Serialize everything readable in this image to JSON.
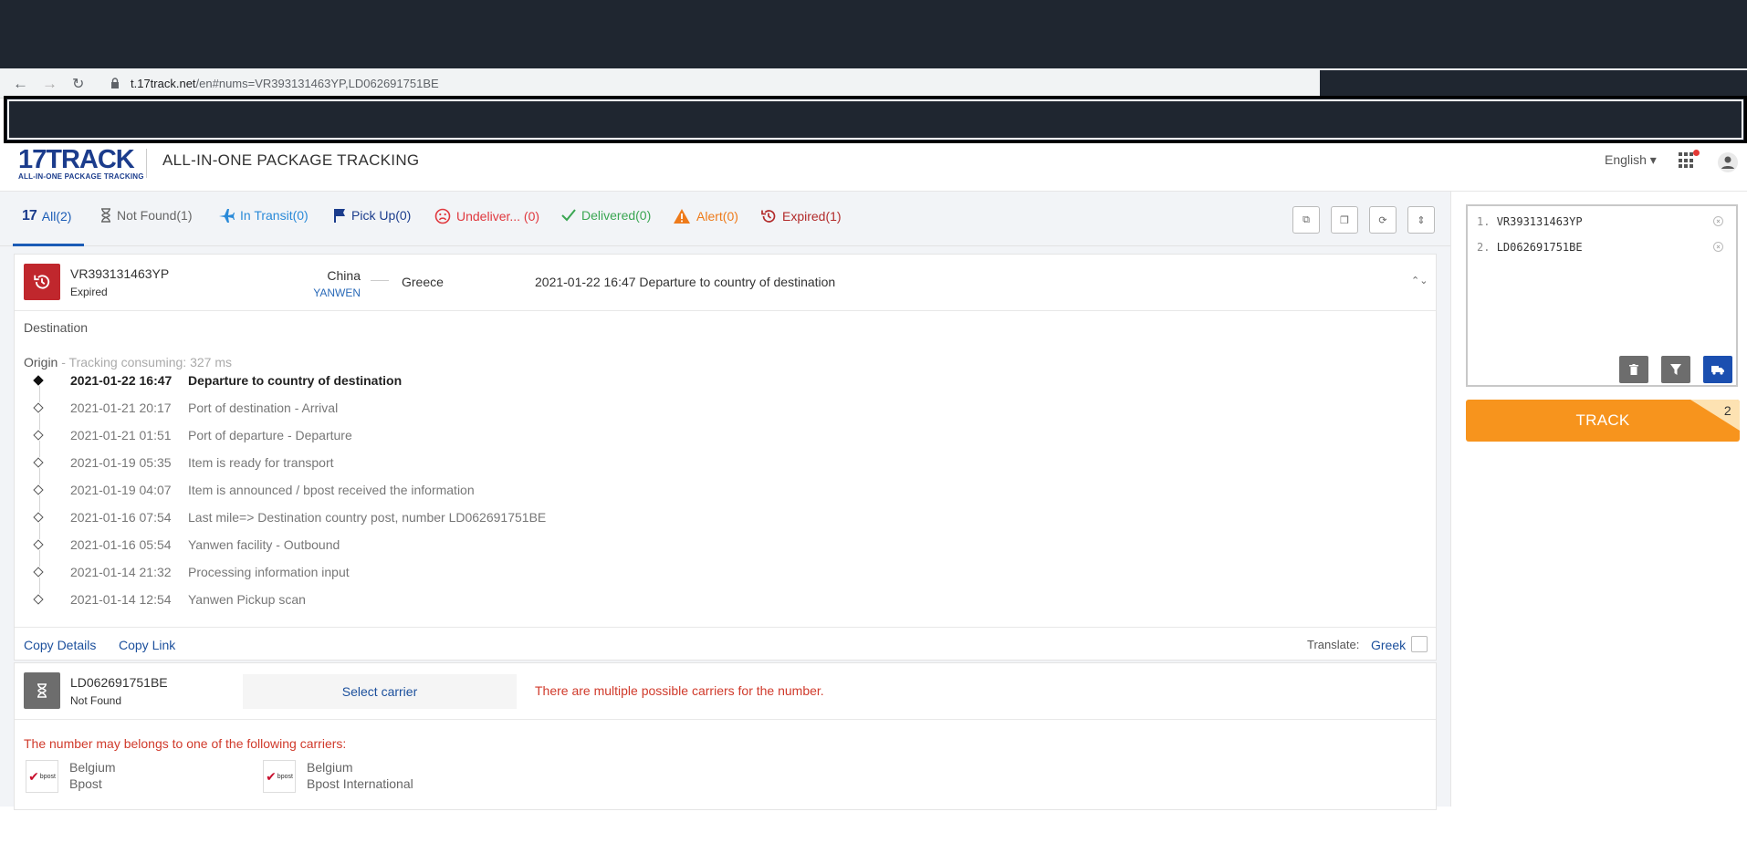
{
  "browser": {
    "url_host": "t.17track.net",
    "url_path": "/en#nums=VR393131463YP,LD062691751BE",
    "back_icon": "arrow-left-icon",
    "forward_icon": "arrow-right-icon",
    "reload_icon": "reload-icon"
  },
  "header": {
    "logo_text": "17TRACK",
    "logo_subtext": "ALL-IN-ONE PACKAGE TRACKING",
    "title": "ALL-IN-ONE PACKAGE TRACKING",
    "language": "English ▾"
  },
  "tabs": [
    {
      "label": "All(2)",
      "color": "#1b5cb6"
    },
    {
      "label": "Not Found(1)",
      "color": "#666666"
    },
    {
      "label": "In Transit(0)",
      "color": "#2a8ad8"
    },
    {
      "label": "Pick Up(0)",
      "color": "#1b3c8c"
    },
    {
      "label": "Undeliver... (0)",
      "color": "#e0383e"
    },
    {
      "label": "Delivered(0)",
      "color": "#3aa652"
    },
    {
      "label": "Alert(0)",
      "color": "#ee7a1a"
    },
    {
      "label": "Expired(1)",
      "color": "#b22a2a"
    }
  ],
  "package1": {
    "number": "VR393131463YP",
    "status": "Expired",
    "status_color": "#c0272d",
    "origin_country": "China",
    "carrier": "YANWEN",
    "destination_country": "Greece",
    "last_event": "2021-01-22 16:47  Departure to country of destination",
    "destination_label": "Destination",
    "origin_label": "Origin",
    "origin_note": " - Tracking consuming: 327 ms",
    "events": [
      {
        "date": "2021-01-22 16:47",
        "desc": "Departure to country of destination"
      },
      {
        "date": "2021-01-21 20:17",
        "desc": "Port of destination - Arrival"
      },
      {
        "date": "2021-01-21 01:51",
        "desc": "Port of departure - Departure"
      },
      {
        "date": "2021-01-19 05:35",
        "desc": "Item is ready for transport"
      },
      {
        "date": "2021-01-19 04:07",
        "desc": "Item is announced / bpost received the information"
      },
      {
        "date": "2021-01-16 07:54",
        "desc": "Last mile=> Destination country post, number LD062691751BE"
      },
      {
        "date": "2021-01-16 05:54",
        "desc": "Yanwen facility - Outbound"
      },
      {
        "date": "2021-01-14 21:32",
        "desc": "Processing information input"
      },
      {
        "date": "2021-01-14 12:54",
        "desc": "Yanwen Pickup scan"
      }
    ],
    "copy_details": "Copy Details",
    "copy_link": "Copy Link",
    "translate_label": "Translate:",
    "translate_lang": "Greek"
  },
  "package2": {
    "number": "LD062691751BE",
    "status": "Not Found",
    "status_color": "#6d6d6d",
    "select_carrier": "Select carrier",
    "warning": "There are multiple possible carriers for the number.",
    "carriers_note": "The number may belongs to one of the following carriers:",
    "carriers": [
      {
        "country": "Belgium",
        "name": "Bpost",
        "logo_text": "bpost"
      },
      {
        "country": "Belgium",
        "name": "Bpost International",
        "logo_text": "bpost"
      }
    ]
  },
  "sidebar": {
    "inputs": [
      {
        "index": "1.",
        "value": "VR393131463YP"
      },
      {
        "index": "2.",
        "value": "LD062691751BE"
      }
    ],
    "track_label": "TRACK",
    "track_count": "2",
    "brand_color": "#f7941d"
  }
}
